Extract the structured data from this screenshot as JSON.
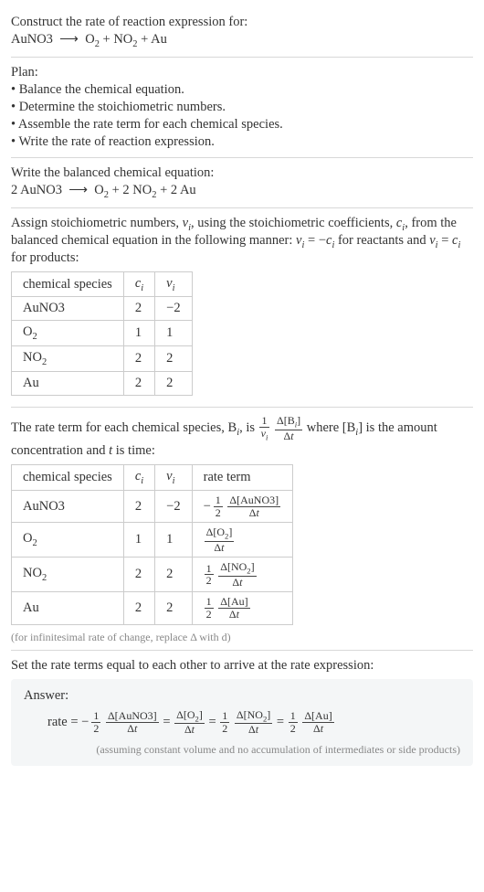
{
  "header": {
    "prompt": "Construct the rate of reaction expression for:",
    "equation": "AuNO3  ⟶  O₂ + NO₂ + Au"
  },
  "plan": {
    "title": "Plan:",
    "items": [
      "Balance the chemical equation.",
      "Determine the stoichiometric numbers.",
      "Assemble the rate term for each chemical species.",
      "Write the rate of reaction expression."
    ]
  },
  "balanced": {
    "title": "Write the balanced chemical equation:",
    "equation": "2 AuNO3  ⟶  O₂ + 2 NO₂ + 2 Au"
  },
  "stoich_intro": {
    "line1_a": "Assign stoichiometric numbers, ",
    "line1_nu": "ν",
    "line1_i": "i",
    "line1_b": ", using the stoichiometric coefficients, ",
    "line1_c": "c",
    "line1_d": ", from",
    "line2_a": "the balanced chemical equation in the following manner: ",
    "line2_b": " = −",
    "line2_c": " for reactants",
    "line3_a": "and ",
    "line3_b": " = ",
    "line3_c": " for products:"
  },
  "table1": {
    "h1": "chemical species",
    "h2": "cᵢ",
    "h3": "νᵢ",
    "rows": [
      {
        "sp": "AuNO3",
        "c": "2",
        "v": "−2"
      },
      {
        "sp": "O₂",
        "c": "1",
        "v": "1"
      },
      {
        "sp": "NO₂",
        "c": "2",
        "v": "2"
      },
      {
        "sp": "Au",
        "c": "2",
        "v": "2"
      }
    ]
  },
  "rate_intro": {
    "a": "The rate term for each chemical species, B",
    "b": ", is ",
    "c": " where [B",
    "d": "] is the amount",
    "e": "concentration and ",
    "f": " is time:",
    "t": "t",
    "i": "i"
  },
  "table2": {
    "h1": "chemical species",
    "h2": "cᵢ",
    "h3": "νᵢ",
    "h4": "rate term",
    "rows": [
      {
        "sp": "AuNO3",
        "c": "2",
        "v": "−2",
        "coef_num": "1",
        "coef_den": "2",
        "dnum": "Δ[AuNO3]",
        "dden": "Δt",
        "neg": true
      },
      {
        "sp": "O₂",
        "c": "1",
        "v": "1",
        "coef_num": "",
        "coef_den": "",
        "dnum": "Δ[O₂]",
        "dden": "Δt",
        "neg": false
      },
      {
        "sp": "NO₂",
        "c": "2",
        "v": "2",
        "coef_num": "1",
        "coef_den": "2",
        "dnum": "Δ[NO₂]",
        "dden": "Δt",
        "neg": false
      },
      {
        "sp": "Au",
        "c": "2",
        "v": "2",
        "coef_num": "1",
        "coef_den": "2",
        "dnum": "Δ[Au]",
        "dden": "Δt",
        "neg": false
      }
    ]
  },
  "infinitesimal_note": "(for infinitesimal rate of change, replace Δ with d)",
  "final_sentence": "Set the rate terms equal to each other to arrive at the rate expression:",
  "answer": {
    "label": "Answer:",
    "rate_eq_prefix": "rate = ",
    "terms": [
      {
        "neg": true,
        "coef_num": "1",
        "coef_den": "2",
        "dnum": "Δ[AuNO3]",
        "dden": "Δt"
      },
      {
        "neg": false,
        "coef_num": "",
        "coef_den": "",
        "dnum": "Δ[O₂]",
        "dden": "Δt"
      },
      {
        "neg": false,
        "coef_num": "1",
        "coef_den": "2",
        "dnum": "Δ[NO₂]",
        "dden": "Δt"
      },
      {
        "neg": false,
        "coef_num": "1",
        "coef_den": "2",
        "dnum": "Δ[Au]",
        "dden": "Δt"
      }
    ],
    "assumption": "(assuming constant volume and no accumulation of intermediates or side products)"
  }
}
